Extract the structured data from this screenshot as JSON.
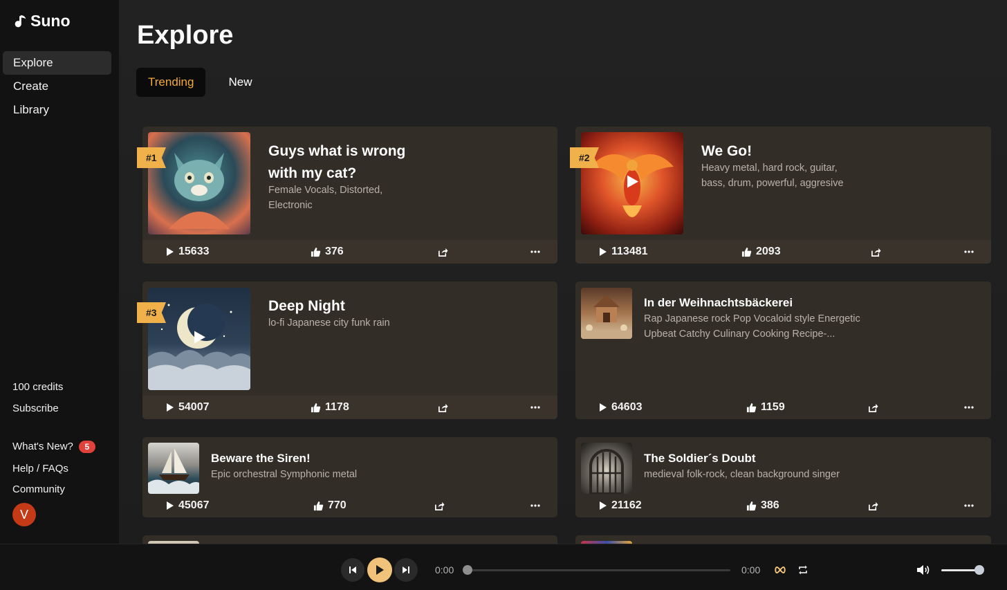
{
  "brand": {
    "name": "Suno"
  },
  "sidebar": {
    "nav": [
      {
        "label": "Explore",
        "active": true
      },
      {
        "label": "Create",
        "active": false
      },
      {
        "label": "Library",
        "active": false
      }
    ],
    "credits": "100 credits",
    "subscribe": "Subscribe",
    "whats_new": "What's New?",
    "whats_new_count": "5",
    "help": "Help / FAQs",
    "community": "Community",
    "avatar_initial": "V"
  },
  "page": {
    "title": "Explore",
    "tabs": [
      {
        "label": "Trending",
        "active": true
      },
      {
        "label": "New",
        "active": false
      }
    ]
  },
  "songs": [
    {
      "rank": "#1",
      "title_line1": "Guys what is wrong",
      "title_line2": "with my cat?",
      "tags_line1": "Female Vocals, Distorted,",
      "tags_line2": "Electronic",
      "plays": "15633",
      "likes": "376",
      "art_icon": "cat-artwork"
    },
    {
      "rank": "#2",
      "title": "We Go!",
      "tags_line1": "Heavy metal, hard rock, guitar,",
      "tags_line2": "bass, drum, powerful, aggresive",
      "plays": "113481",
      "likes": "2093",
      "art_icon": "phoenix-artwork"
    },
    {
      "rank": "#3",
      "title": "Deep Night",
      "tags_line1": "lo-fi Japanese city funk rain",
      "plays": "54007",
      "likes": "1178",
      "art_icon": "moon-night-artwork"
    },
    {
      "title": "In der Weihnachtsbäckerei",
      "tags_line1": "Rap Japanese rock Pop Vocaloid style Energetic",
      "tags_line2": "Upbeat Catchy Culinary Cooking Recipe-...",
      "plays": "64603",
      "likes": "1159",
      "art_icon": "bakery-artwork"
    },
    {
      "title": "Beware the Siren!",
      "tags_line1": "Epic orchestral Symphonic metal",
      "plays": "45067",
      "likes": "770",
      "art_icon": "ship-storm-artwork"
    },
    {
      "title": "The Soldier´s Doubt",
      "tags_line1": "medieval folk-rock, clean background singer",
      "plays": "21162",
      "likes": "386",
      "art_icon": "prison-gate-artwork"
    }
  ],
  "player": {
    "current_time": "0:00",
    "duration": "0:00",
    "progress": 0,
    "volume": 0.9
  },
  "colors": {
    "accent": "#f3a93a",
    "card": "#332d27",
    "rank_badge": "#f0b04a",
    "play_button": "#f0c27a"
  }
}
